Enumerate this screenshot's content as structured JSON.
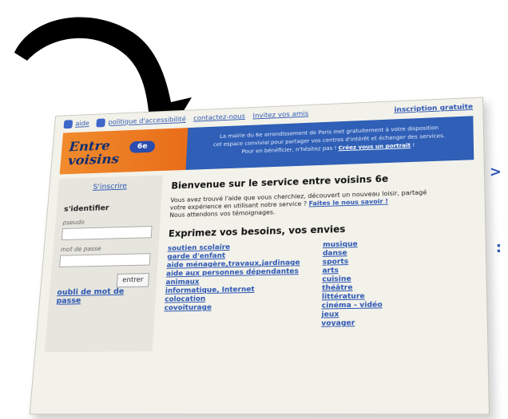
{
  "top_links": {
    "aide": "aide",
    "politique": "politique d'accessibilité",
    "contact": "contactez-nous",
    "invite": "Invitez vos amis",
    "inscription": "inscription gratuite"
  },
  "banner": {
    "brand_line1": "Entre",
    "brand_line2": "voisins",
    "brand_badge": "6e",
    "message_line1": "La mairie du 6e arrondissement de Paris met gratuitement à votre disposition",
    "message_line2": "cet espace convivial pour partager vos centres d'intérêt et échanger des services.",
    "message_line3_prefix": "Pour en bénéficier, n'hésitez pas !",
    "message_link": "Créez vous un portrait",
    "message_line3_suffix": "!"
  },
  "sidebar": {
    "signup_link": "S'inscrire",
    "identify_title": "s'identifier",
    "pseudo_label": "pseudo",
    "password_label": "mot de passe",
    "enter_button": "entrer",
    "forgot_link": "oubli de mot de passe"
  },
  "main": {
    "title": "Bienvenue sur le service entre voisins 6e",
    "intro_line1": "Vous avez trouvé l'aide que vous cherchiez, découvert un nouveau loisir, partagé",
    "intro_line2_prefix": "votre expérience en utilisant notre service ?",
    "intro_link": "Faites le nous savoir !",
    "intro_line3": "Nous attendons vos témoignages.",
    "section_title": "Exprimez vos besoins, vos envies",
    "needs_left": [
      "soutien scolaire",
      "garde d'enfant",
      "aide ménagère,travaux,jardinage",
      "aide aux personnes dépendantes",
      "animaux",
      "informatique, Internet",
      "colocation",
      "covoiturage"
    ],
    "needs_right": [
      "musique",
      "danse",
      "sports",
      "arts",
      "cuisine",
      "théâtre",
      "littérature",
      "cinéma - vidéo",
      "jeux",
      "voyager"
    ]
  },
  "page_edge_marks": {
    "mark1": ">",
    "mark2": ":"
  },
  "colors": {
    "blue_link": "#2b56b3",
    "banner_blue": "#2f5fb6",
    "orange": "#f08b2c"
  }
}
